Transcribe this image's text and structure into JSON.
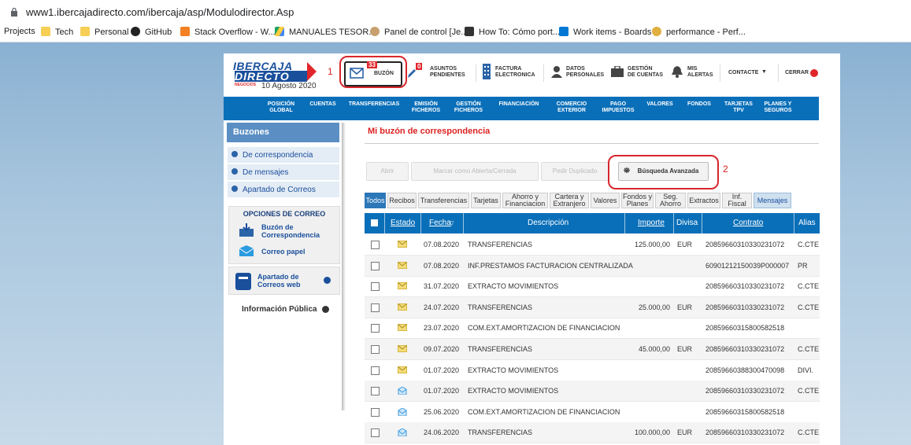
{
  "browser": {
    "url": "www1.ibercajadirecto.com/ibercaja/asp/Modulodirector.Asp",
    "bookmarks": [
      "Projects",
      "Tech",
      "Personal",
      "GitHub",
      "Stack Overflow - W...",
      "MANUALES TESOR...",
      "Panel de control [Je...",
      "How To: Cómo port...",
      "Work items - Boards",
      "performance - Perf..."
    ]
  },
  "header": {
    "logo_top": "IBERCAJA",
    "logo_bottom": "DIRECTO",
    "logo_sub": "NEGOCIOS",
    "date": "10 Agosto 2020",
    "buzon_label": "BUZÓN",
    "buzon_count": "33",
    "asuntos_label": "ASUNTOS\nPENDIENTES",
    "asuntos_count": "0",
    "factura_label": "FACTURA\nELECTRONICA",
    "datos_label": "DATOS\nPERSONALES",
    "gestion_label": "GESTIÓN\nDE CUENTAS",
    "alertas_label": "MIS\nALERTAS",
    "contacte_label": "CONTACTE",
    "cerrar_label": "CERRAR"
  },
  "annotations": [
    "1",
    "2"
  ],
  "nav": [
    "POSICIÓN\nGLOBAL",
    "CUENTAS",
    "TRANSFERENCIAS",
    "EMISIÓN\nFICHEROS",
    "GESTIÓN\nFICHEROS",
    "FINANCIACIÓN",
    "COMERCIO\nEXTERIOR",
    "PAGO\nIMPUESTOS",
    "VALORES",
    "FONDOS",
    "TARJETAS\nTPV",
    "PLANES Y\nSEGUROS"
  ],
  "sidebar": {
    "title": "Buzones",
    "items": [
      "De correspondencia",
      "De mensajes",
      "Apartado de Correos"
    ],
    "opciones_title": "OPCIONES DE CORREO",
    "buzon_corr": "Buzón de\nCorrespondencia",
    "correo_papel": "Correo papel",
    "apartado_web": "Apartado de\nCorreos web",
    "info_publica": "Información Pública"
  },
  "content": {
    "title": "Mi buzón de correspondencia",
    "actions": [
      "Abrir",
      "Marcar como Abierta/Cerrada",
      "Pedir Duplicado",
      "Búsqueda Avanzada"
    ],
    "tabs": [
      "Todos",
      "Recibos",
      "Transferencias",
      "Tarjetas",
      "Ahorro y\nFinanciacion",
      "Cartera y\nExtranjero",
      "Valores",
      "Fondos y\nPlanes",
      "Seg.\nAhorro",
      "Extractos",
      "Inf.\nFiscal",
      "Mensajes"
    ]
  },
  "table": {
    "headers": [
      "Estado",
      "Fecha",
      "Descripción",
      "Importe",
      "Divisa",
      "Contrato",
      "Alias"
    ],
    "rows": [
      {
        "fecha": "07.08.2020",
        "desc": "TRANSFERENCIAS",
        "importe": "125.000,00",
        "divisa": "EUR",
        "contrato": "20859660310330231072",
        "alias": "C.CTE",
        "estado": "closed"
      },
      {
        "fecha": "07.08.2020",
        "desc": "INF.PRESTAMOS FACTURACION CENTRALIZADA",
        "importe": "",
        "divisa": "",
        "contrato": "60901212150039P000007",
        "alias": "PR",
        "estado": "closed"
      },
      {
        "fecha": "31.07.2020",
        "desc": "EXTRACTO MOVIMIENTOS",
        "importe": "",
        "divisa": "",
        "contrato": "20859660310330231072",
        "alias": "C.CTE",
        "estado": "closed"
      },
      {
        "fecha": "24.07.2020",
        "desc": "TRANSFERENCIAS",
        "importe": "25.000,00",
        "divisa": "EUR",
        "contrato": "20859660310330231072",
        "alias": "C.CTE",
        "estado": "closed"
      },
      {
        "fecha": "23.07.2020",
        "desc": "COM.EXT.AMORTIZACION DE FINANCIACION",
        "importe": "",
        "divisa": "",
        "contrato": "20859660315800582518",
        "alias": "",
        "estado": "closed"
      },
      {
        "fecha": "09.07.2020",
        "desc": "TRANSFERENCIAS",
        "importe": "45.000,00",
        "divisa": "EUR",
        "contrato": "20859660310330231072",
        "alias": "C.CTE",
        "estado": "closed"
      },
      {
        "fecha": "01.07.2020",
        "desc": "EXTRACTO MOVIMIENTOS",
        "importe": "",
        "divisa": "",
        "contrato": "20859660388300470098",
        "alias": "DIVI.",
        "estado": "closed"
      },
      {
        "fecha": "01.07.2020",
        "desc": "EXTRACTO MOVIMIENTOS",
        "importe": "",
        "divisa": "",
        "contrato": "20859660310330231072",
        "alias": "C.CTE",
        "estado": "open"
      },
      {
        "fecha": "25.06.2020",
        "desc": "COM.EXT.AMORTIZACION DE FINANCIACION",
        "importe": "",
        "divisa": "",
        "contrato": "20859660315800582518",
        "alias": "",
        "estado": "open"
      },
      {
        "fecha": "24.06.2020",
        "desc": "TRANSFERENCIAS",
        "importe": "100.000,00",
        "divisa": "EUR",
        "contrato": "20859660310330231072",
        "alias": "C.CTE",
        "estado": "open"
      }
    ]
  },
  "colors": {
    "brand_blue": "#0a6fb9",
    "brand_red": "#e0262b",
    "mark_red": "#d8262c"
  }
}
